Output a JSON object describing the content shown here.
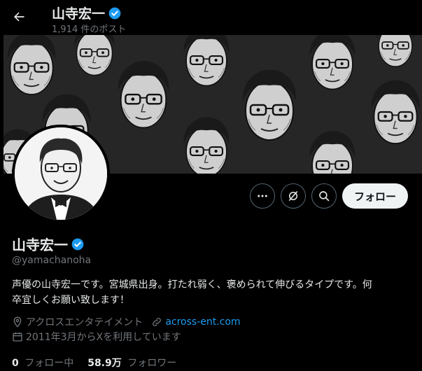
{
  "header": {
    "name": "山寺宏一",
    "post_count": "1,914 件のポスト"
  },
  "actions": {
    "follow_label": "フォロー"
  },
  "profile": {
    "name": "山寺宏一",
    "handle": "@yamachanoha",
    "bio_line1": "声優の山寺宏一です。宮城県出身。打たれ弱く、褒められて伸びるタイプです。何",
    "bio_line2": "卒宜しくお願い致します！",
    "location": "アクロスエンタテイメント",
    "website": "across-ent.com",
    "joined": "2011年3月からXを利用しています",
    "following_count": "0",
    "following_label": "フォロー中",
    "followers_count": "58.9万",
    "followers_label": "フォロワー"
  },
  "colors": {
    "background": "#000000",
    "verified": "#1d9bf0",
    "link": "#1d9bf0",
    "muted": "#71767b",
    "follow_button_bg": "#eff3f4"
  }
}
